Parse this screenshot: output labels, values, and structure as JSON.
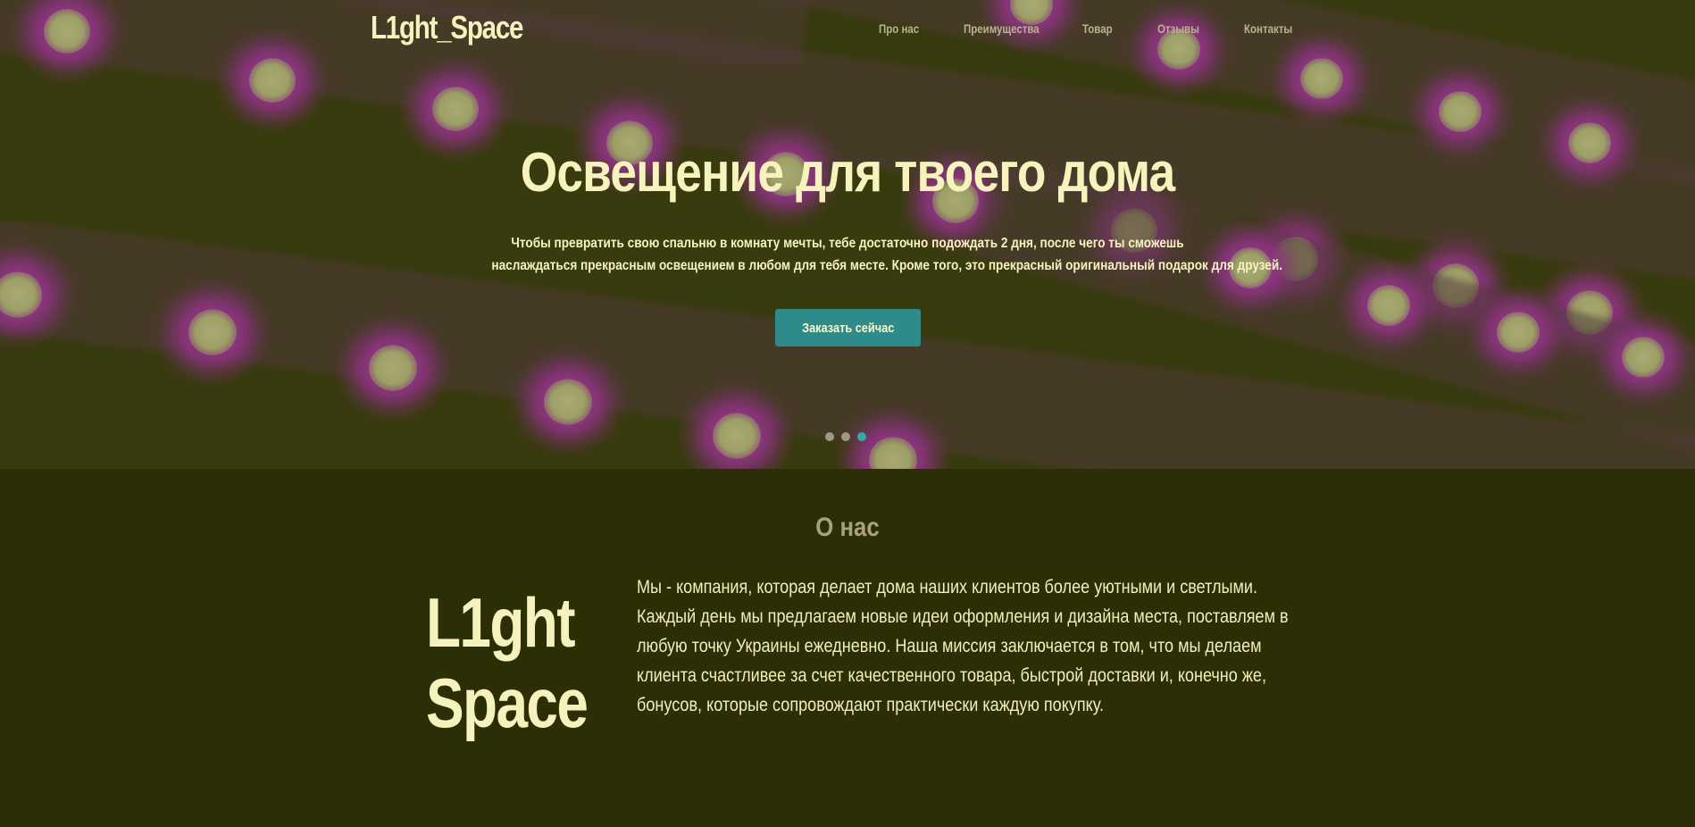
{
  "brand": {
    "name": "L1ght_Space"
  },
  "nav": {
    "items": [
      {
        "label": "Про нас"
      },
      {
        "label": "Преимущества"
      },
      {
        "label": "Товар"
      },
      {
        "label": "Отзывы"
      },
      {
        "label": "Контакты"
      }
    ]
  },
  "hero": {
    "title": "Освещение для твоего дома",
    "text_line1": "Чтобы превратить свою спальню в комнату мечты, тебе достаточно подождать 2 дня, после чего ты сможешь",
    "text_line2": "наслаждаться прекрасным освещением в любом для тебя месте. Кроме того, это прекрасный оригинальный подарок для друзей.",
    "cta_label": "Заказать сейчас",
    "slider": {
      "count": 3,
      "active_index": 3
    }
  },
  "about": {
    "title": "О нас",
    "logo_line1": "L1ght",
    "logo_line2": "Space",
    "lines": [
      "Мы - компания, которая делает дома наших клиентов более уютными и светлыми.",
      "Каждый день мы предлагаем новые идеи оформления и дизайна места, поставляем в",
      "любую точку Украины ежедневно. Наша миссия заключается в том, что мы делаем",
      "клиента счастливее за счет качественного товара, быстрой доставки и, конечно же,",
      "бонусов, которые сопровождают практически каждую покупку."
    ]
  },
  "colors": {
    "background": "#2c2f06",
    "hero_base": "#3b3d10",
    "strip": "#5a2f5a",
    "led_glow": "#c234c0",
    "led_core": "#c9c98c",
    "accent": "#2f8b8a",
    "text": "#f4f0b8",
    "muted": "#a8a27c"
  }
}
